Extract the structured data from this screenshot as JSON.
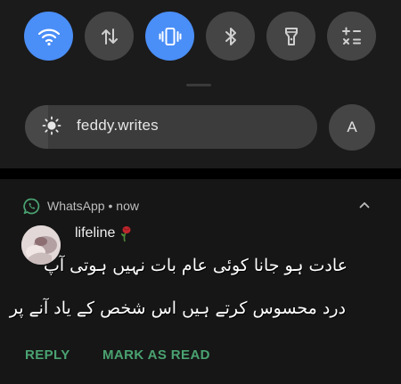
{
  "quick_settings": {
    "tiles": [
      {
        "icon": "wifi-icon",
        "state": "on"
      },
      {
        "icon": "mobile-data-icon",
        "state": "off"
      },
      {
        "icon": "vibrate-icon",
        "state": "on"
      },
      {
        "icon": "bluetooth-icon",
        "state": "off"
      },
      {
        "icon": "flashlight-icon",
        "state": "off"
      },
      {
        "icon": "calculator-icon",
        "state": "off"
      }
    ],
    "colors": {
      "active": "#4a8ef7",
      "inactive": "#454545"
    },
    "brightness": {
      "label": "feddy.writes",
      "level": 0.08
    },
    "profile_initial": "A"
  },
  "notification": {
    "app_name": "WhatsApp",
    "separator": " • ",
    "time": "now",
    "sender": "lifeline",
    "message_lines": [
      "عادت ہو جانا کوئی عام بات نہیں ہوتی آپ",
      "درد محسوس کرتے ہیں اس شخص کے یاد آنے پر"
    ],
    "actions": {
      "reply": "REPLY",
      "mark_as_read": "MARK AS READ"
    },
    "accent_color": "#4aa271"
  }
}
